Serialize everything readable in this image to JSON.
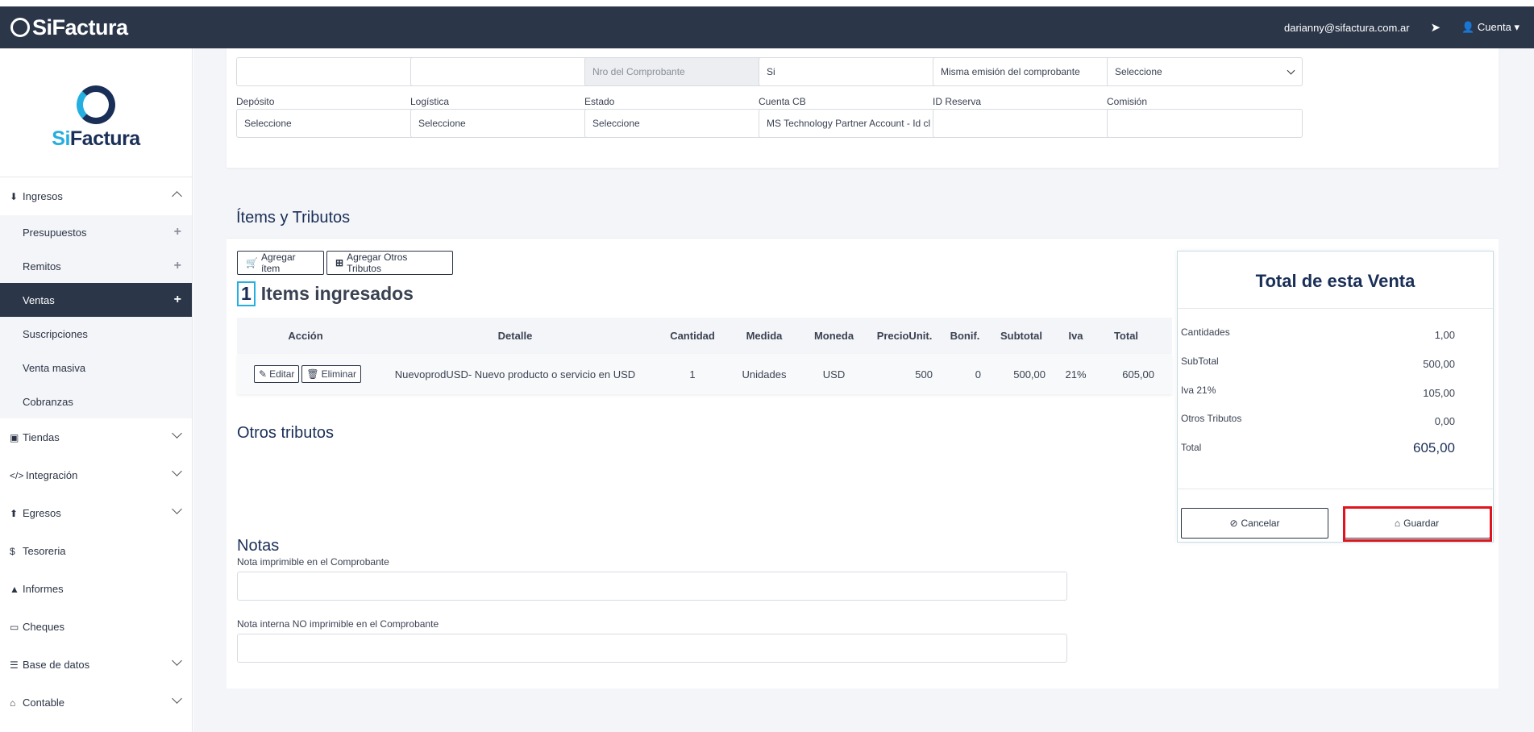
{
  "topbar": {
    "brand": "SiFactura",
    "email": "darianny@sifactura.com.ar",
    "account_label": "Cuenta"
  },
  "sidebar": {
    "logo_si": "Si",
    "logo_factura": "Factura",
    "items": [
      {
        "label": "Ingresos",
        "icon": "download-icon"
      },
      {
        "label": "Presupuestos"
      },
      {
        "label": "Remitos"
      },
      {
        "label": "Ventas"
      },
      {
        "label": "Suscripciones"
      },
      {
        "label": "Venta masiva"
      },
      {
        "label": "Cobranzas"
      },
      {
        "label": "Tiendas",
        "icon": "store-icon"
      },
      {
        "label": "Integración",
        "icon": "code-icon"
      },
      {
        "label": "Egresos",
        "icon": "upload-icon"
      },
      {
        "label": "Tesoreria",
        "icon": "dollar-icon"
      },
      {
        "label": "Informes",
        "icon": "chart-icon"
      },
      {
        "label": "Cheques",
        "icon": "card-icon"
      },
      {
        "label": "Base de datos",
        "icon": "database-icon"
      },
      {
        "label": "Contable",
        "icon": "bank-icon"
      }
    ]
  },
  "form": {
    "row1": [
      {
        "value": ""
      },
      {
        "value": ""
      },
      {
        "value": "Nro del Comprobante"
      },
      {
        "value": "Si"
      },
      {
        "value": "Misma emisión del comprobante"
      },
      {
        "value": "Seleccione"
      }
    ],
    "row2": [
      {
        "label": "Depósito",
        "value": "Seleccione"
      },
      {
        "label": "Logística",
        "value": "Seleccione"
      },
      {
        "label": "Estado",
        "value": "Seleccione"
      },
      {
        "label": "Cuenta CB",
        "value": "MS Technology Partner Account - Id cl"
      },
      {
        "label": "ID Reserva",
        "value": ""
      },
      {
        "label": "Comisión",
        "value": ""
      }
    ]
  },
  "items_section": {
    "title": "Ítems y Tributos",
    "add_item": "Agregar ítem",
    "add_other": "Agregar Otros Tributos",
    "count": "1",
    "count_label": "Items ingresados",
    "columns": [
      "Acción",
      "Detalle",
      "Cantidad",
      "Medida",
      "Moneda",
      "PrecioUnit.",
      "Bonif.",
      "Subtotal",
      "Iva",
      "Total"
    ],
    "rows": [
      {
        "edit": "Editar",
        "delete": "Eliminar",
        "detalle": "NuevoprodUSD- Nuevo producto o servicio en USD",
        "cantidad": "1",
        "medida": "Unidades",
        "moneda": "USD",
        "precio": "500",
        "bonif": "0",
        "subtotal": "500,00",
        "iva": "21%",
        "total": "605,00"
      }
    ],
    "otros_title": "Otros tributos",
    "notas_title": "Notas",
    "nota1_label": "Nota imprimible en el Comprobante",
    "nota2_label": "Nota interna NO imprimible en el Comprobante"
  },
  "totals": {
    "title": "Total de esta Venta",
    "rows": [
      {
        "label": "Cantidades",
        "value": "1,00"
      },
      {
        "label": "SubTotal",
        "value": "500,00"
      },
      {
        "label": "Iva 21%",
        "value": "105,00"
      },
      {
        "label": "Otros Tributos",
        "value": "0,00"
      },
      {
        "label": "Total",
        "value": "605,00"
      }
    ],
    "cancel": "Cancelar",
    "save": "Guardar"
  },
  "colors": {
    "navy": "#2b3649",
    "accent": "#25aee0",
    "highlight": "#e0141e"
  }
}
